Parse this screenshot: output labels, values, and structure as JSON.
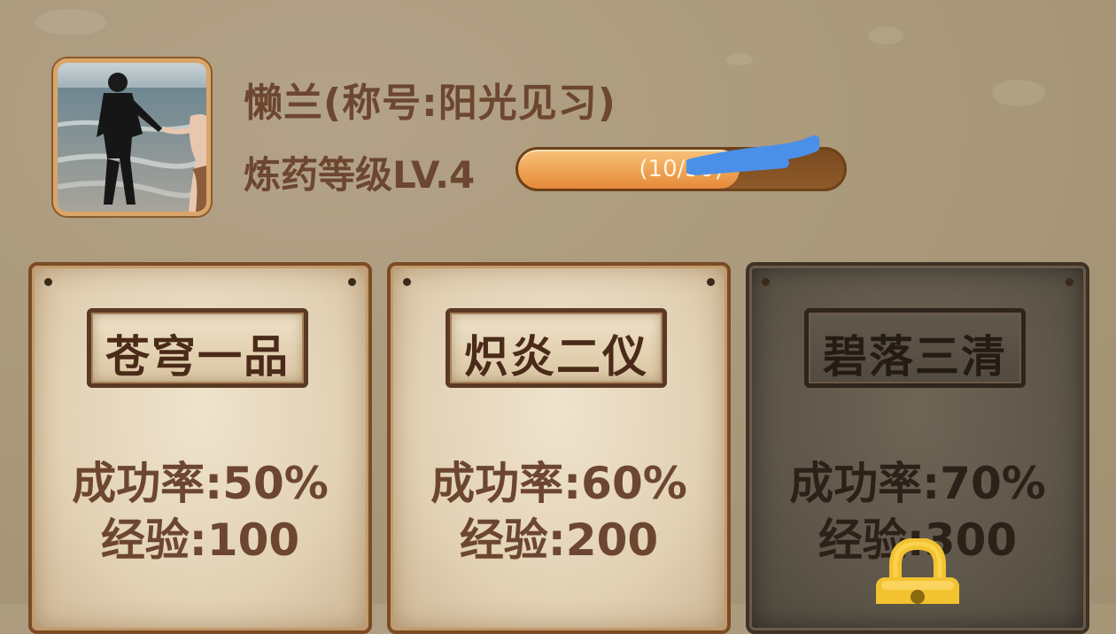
{
  "profile": {
    "name": "懒兰(称号:阳光见习)",
    "level_label": "炼药等级LV.4",
    "exp_text": "(10/50)",
    "exp_progress": 0.68
  },
  "cards": [
    {
      "title": "苍穹一品",
      "rate": "成功率:50%",
      "exp": "经验:100",
      "locked": false
    },
    {
      "title": "炽炎二仪",
      "rate": "成功率:60%",
      "exp": "经验:200",
      "locked": false
    },
    {
      "title": "碧落三清",
      "rate": "成功率:70%",
      "exp": "经验:300",
      "locked": true
    }
  ],
  "icons": {
    "lock": "lock-icon",
    "avatar": "avatar-photo"
  },
  "colors": {
    "text_brown": "#6c4630",
    "exp_fill": "#f0a95b",
    "exp_track": "#8e5a2a",
    "lock_gold": "#f2c230"
  }
}
